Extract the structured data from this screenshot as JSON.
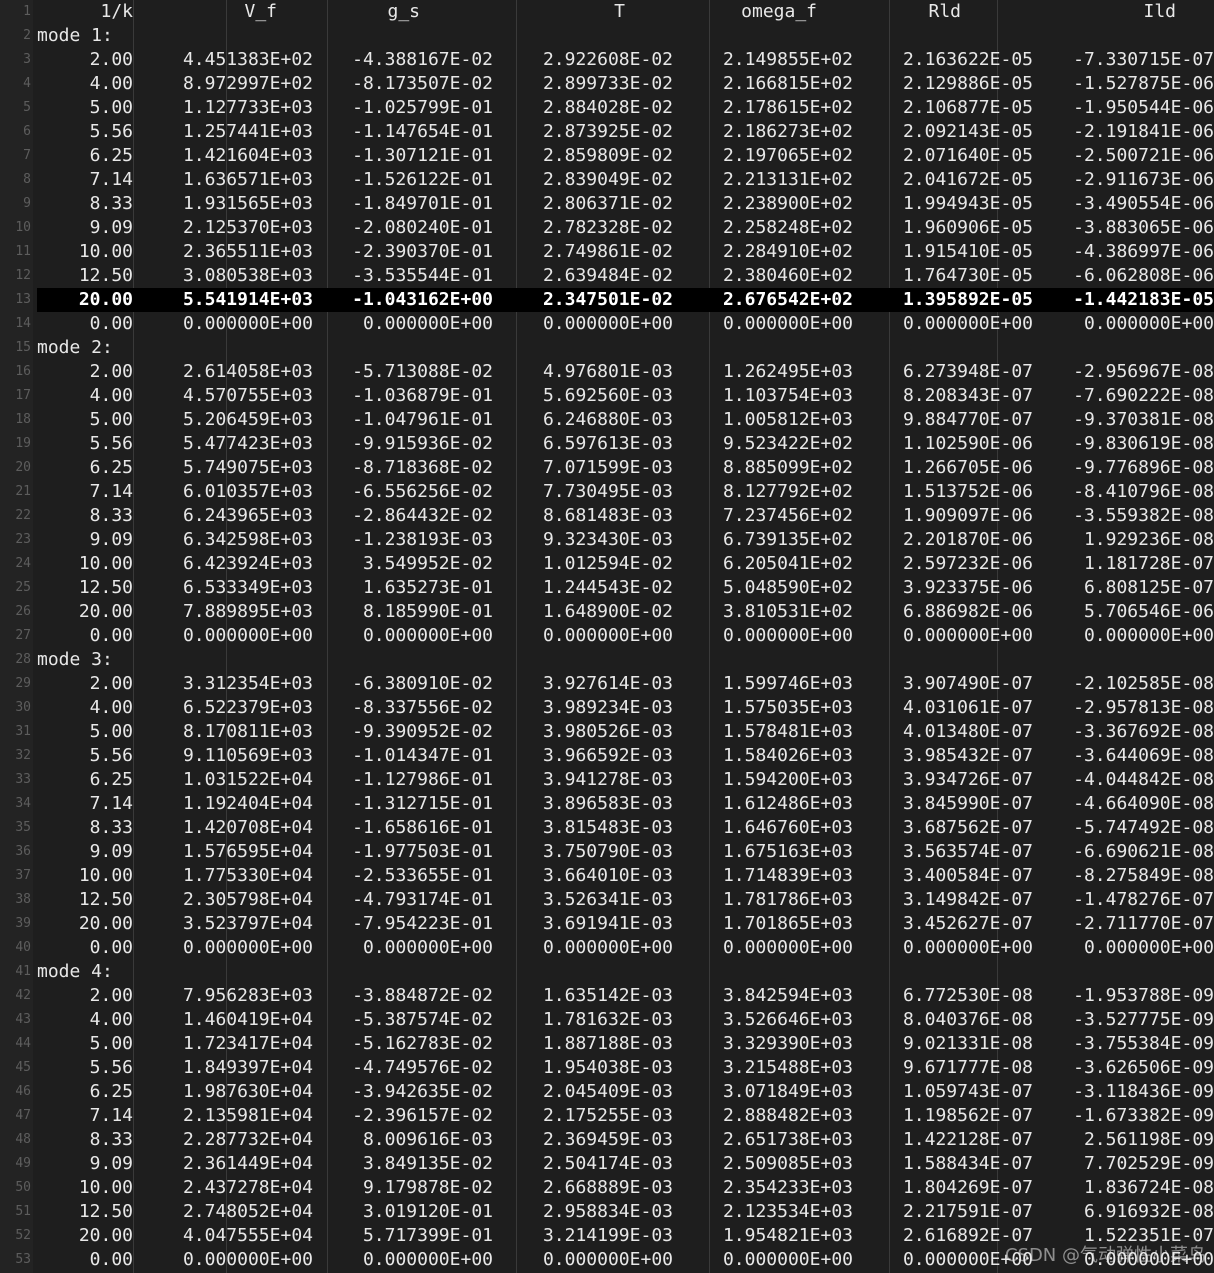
{
  "editor": {
    "current_line": 13,
    "header": [
      "1/k",
      "V_f",
      "g_s",
      "T",
      "omega_f",
      "Rld",
      "Ild"
    ],
    "blocks": [
      {
        "label": "mode 1:",
        "rows": [
          [
            "2.00",
            "4.451383E+02",
            "-4.388167E-02",
            "2.922608E-02",
            "2.149855E+02",
            "2.163622E-05",
            "-7.330715E-07"
          ],
          [
            "4.00",
            "8.972997E+02",
            "-8.173507E-02",
            "2.899733E-02",
            "2.166815E+02",
            "2.129886E-05",
            "-1.527875E-06"
          ],
          [
            "5.00",
            "1.127733E+03",
            "-1.025799E-01",
            "2.884028E-02",
            "2.178615E+02",
            "2.106877E-05",
            "-1.950544E-06"
          ],
          [
            "5.56",
            "1.257441E+03",
            "-1.147654E-01",
            "2.873925E-02",
            "2.186273E+02",
            "2.092143E-05",
            "-2.191841E-06"
          ],
          [
            "6.25",
            "1.421604E+03",
            "-1.307121E-01",
            "2.859809E-02",
            "2.197065E+02",
            "2.071640E-05",
            "-2.500721E-06"
          ],
          [
            "7.14",
            "1.636571E+03",
            "-1.526122E-01",
            "2.839049E-02",
            "2.213131E+02",
            "2.041672E-05",
            "-2.911673E-06"
          ],
          [
            "8.33",
            "1.931565E+03",
            "-1.849701E-01",
            "2.806371E-02",
            "2.238900E+02",
            "1.994943E-05",
            "-3.490554E-06"
          ],
          [
            "9.09",
            "2.125370E+03",
            "-2.080240E-01",
            "2.782328E-02",
            "2.258248E+02",
            "1.960906E-05",
            "-3.883065E-06"
          ],
          [
            "10.00",
            "2.365511E+03",
            "-2.390370E-01",
            "2.749861E-02",
            "2.284910E+02",
            "1.915410E-05",
            "-4.386997E-06"
          ],
          [
            "12.50",
            "3.080538E+03",
            "-3.535544E-01",
            "2.639484E-02",
            "2.380460E+02",
            "1.764730E-05",
            "-6.062808E-06"
          ],
          [
            "20.00",
            "5.541914E+03",
            "-1.043162E+00",
            "2.347501E-02",
            "2.676542E+02",
            "1.395892E-05",
            "-1.442183E-05"
          ],
          [
            "0.00",
            "0.000000E+00",
            "0.000000E+00",
            "0.000000E+00",
            "0.000000E+00",
            "0.000000E+00",
            "0.000000E+00"
          ]
        ]
      },
      {
        "label": "mode 2:",
        "rows": [
          [
            "2.00",
            "2.614058E+03",
            "-5.713088E-02",
            "4.976801E-03",
            "1.262495E+03",
            "6.273948E-07",
            "-2.956967E-08"
          ],
          [
            "4.00",
            "4.570755E+03",
            "-1.036879E-01",
            "5.692560E-03",
            "1.103754E+03",
            "8.208343E-07",
            "-7.690222E-08"
          ],
          [
            "5.00",
            "5.206459E+03",
            "-1.047961E-01",
            "6.246880E-03",
            "1.005812E+03",
            "9.884770E-07",
            "-9.370381E-08"
          ],
          [
            "5.56",
            "5.477423E+03",
            "-9.915936E-02",
            "6.597613E-03",
            "9.523422E+02",
            "1.102590E-06",
            "-9.830619E-08"
          ],
          [
            "6.25",
            "5.749075E+03",
            "-8.718368E-02",
            "7.071599E-03",
            "8.885099E+02",
            "1.266705E-06",
            "-9.776896E-08"
          ],
          [
            "7.14",
            "6.010357E+03",
            "-6.556256E-02",
            "7.730495E-03",
            "8.127792E+02",
            "1.513752E-06",
            "-8.410796E-08"
          ],
          [
            "8.33",
            "6.243965E+03",
            "-2.864432E-02",
            "8.681483E-03",
            "7.237456E+02",
            "1.909097E-06",
            "-3.559382E-08"
          ],
          [
            "9.09",
            "6.342598E+03",
            "-1.238193E-03",
            "9.323430E-03",
            "6.739135E+02",
            "2.201870E-06",
            "1.929236E-08"
          ],
          [
            "10.00",
            "6.423924E+03",
            "3.549952E-02",
            "1.012594E-02",
            "6.205041E+02",
            "2.597232E-06",
            "1.181728E-07"
          ],
          [
            "12.50",
            "6.533349E+03",
            "1.635273E-01",
            "1.244543E-02",
            "5.048590E+02",
            "3.923375E-06",
            "6.808125E-07"
          ],
          [
            "20.00",
            "7.889895E+03",
            "8.185990E-01",
            "1.648900E-02",
            "3.810531E+02",
            "6.886982E-06",
            "5.706546E-06"
          ],
          [
            "0.00",
            "0.000000E+00",
            "0.000000E+00",
            "0.000000E+00",
            "0.000000E+00",
            "0.000000E+00",
            "0.000000E+00"
          ]
        ]
      },
      {
        "label": "mode 3:",
        "rows": [
          [
            "2.00",
            "3.312354E+03",
            "-6.380910E-02",
            "3.927614E-03",
            "1.599746E+03",
            "3.907490E-07",
            "-2.102585E-08"
          ],
          [
            "4.00",
            "6.522379E+03",
            "-8.337556E-02",
            "3.989234E-03",
            "1.575035E+03",
            "4.031061E-07",
            "-2.957813E-08"
          ],
          [
            "5.00",
            "8.170811E+03",
            "-9.390952E-02",
            "3.980526E-03",
            "1.578481E+03",
            "4.013480E-07",
            "-3.367692E-08"
          ],
          [
            "5.56",
            "9.110569E+03",
            "-1.014347E-01",
            "3.966592E-03",
            "1.584026E+03",
            "3.985432E-07",
            "-3.644069E-08"
          ],
          [
            "6.25",
            "1.031522E+04",
            "-1.127986E-01",
            "3.941278E-03",
            "1.594200E+03",
            "3.934726E-07",
            "-4.044842E-08"
          ],
          [
            "7.14",
            "1.192404E+04",
            "-1.312715E-01",
            "3.896583E-03",
            "1.612486E+03",
            "3.845990E-07",
            "-4.664090E-08"
          ],
          [
            "8.33",
            "1.420708E+04",
            "-1.658616E-01",
            "3.815483E-03",
            "1.646760E+03",
            "3.687562E-07",
            "-5.747492E-08"
          ],
          [
            "9.09",
            "1.576595E+04",
            "-1.977503E-01",
            "3.750790E-03",
            "1.675163E+03",
            "3.563574E-07",
            "-6.690621E-08"
          ],
          [
            "10.00",
            "1.775330E+04",
            "-2.533655E-01",
            "3.664010E-03",
            "1.714839E+03",
            "3.400584E-07",
            "-8.275849E-08"
          ],
          [
            "12.50",
            "2.305798E+04",
            "-4.793174E-01",
            "3.526341E-03",
            "1.781786E+03",
            "3.149842E-07",
            "-1.478276E-07"
          ],
          [
            "20.00",
            "3.523797E+04",
            "-7.954223E-01",
            "3.691941E-03",
            "1.701865E+03",
            "3.452627E-07",
            "-2.711770E-07"
          ],
          [
            "0.00",
            "0.000000E+00",
            "0.000000E+00",
            "0.000000E+00",
            "0.000000E+00",
            "0.000000E+00",
            "0.000000E+00"
          ]
        ]
      },
      {
        "label": "mode 4:",
        "rows": [
          [
            "2.00",
            "7.956283E+03",
            "-3.884872E-02",
            "1.635142E-03",
            "3.842594E+03",
            "6.772530E-08",
            "-1.953788E-09"
          ],
          [
            "4.00",
            "1.460419E+04",
            "-5.387574E-02",
            "1.781632E-03",
            "3.526646E+03",
            "8.040376E-08",
            "-3.527775E-09"
          ],
          [
            "5.00",
            "1.723417E+04",
            "-5.162783E-02",
            "1.887188E-03",
            "3.329390E+03",
            "9.021331E-08",
            "-3.755384E-09"
          ],
          [
            "5.56",
            "1.849397E+04",
            "-4.749576E-02",
            "1.954038E-03",
            "3.215488E+03",
            "9.671777E-08",
            "-3.626506E-09"
          ],
          [
            "6.25",
            "1.987630E+04",
            "-3.942635E-02",
            "2.045409E-03",
            "3.071849E+03",
            "1.059743E-07",
            "-3.118436E-09"
          ],
          [
            "7.14",
            "2.135981E+04",
            "-2.396157E-02",
            "2.175255E-03",
            "2.888482E+03",
            "1.198562E-07",
            "-1.673382E-09"
          ],
          [
            "8.33",
            "2.287732E+04",
            "8.009616E-03",
            "2.369459E-03",
            "2.651738E+03",
            "1.422128E-07",
            "2.561198E-09"
          ],
          [
            "9.09",
            "2.361449E+04",
            "3.849135E-02",
            "2.504174E-03",
            "2.509085E+03",
            "1.588434E-07",
            "7.702529E-09"
          ],
          [
            "10.00",
            "2.437278E+04",
            "9.179878E-02",
            "2.668889E-03",
            "2.354233E+03",
            "1.804269E-07",
            "1.836724E-08"
          ],
          [
            "12.50",
            "2.748052E+04",
            "3.019120E-01",
            "2.958834E-03",
            "2.123534E+03",
            "2.217591E-07",
            "6.916932E-08"
          ],
          [
            "20.00",
            "4.047555E+04",
            "5.717399E-01",
            "3.214199E-03",
            "1.954821E+03",
            "2.616892E-07",
            "1.522351E-07"
          ],
          [
            "0.00",
            "0.000000E+00",
            "0.000000E+00",
            "0.000000E+00",
            "0.000000E+00",
            "0.000000E+00",
            "0.000000E+00"
          ]
        ]
      }
    ]
  },
  "watermark": "CSDN @气动弹性小菜鸟"
}
